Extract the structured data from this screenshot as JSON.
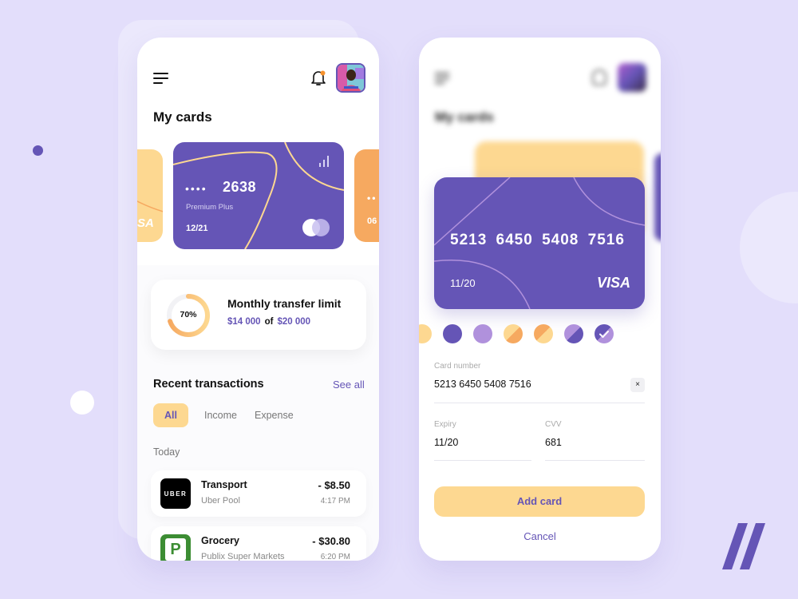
{
  "colors": {
    "background": "#e3defb",
    "accent_purple": "#6555b6",
    "accent_yellow": "#fdd891",
    "accent_orange": "#f6a960",
    "light_purple": "#b091dc",
    "notification_dot": "#f6922d"
  },
  "left_screen": {
    "header": {
      "menu_icon": "hamburger-menu-icon",
      "bell_icon": "bell-icon",
      "has_notification": true,
      "avatar": "user-avatar"
    },
    "title": "My cards",
    "cards": [
      {
        "position": "left-peek",
        "color": "#fdd891",
        "brand": "VISA",
        "brand_visible_text": "SA"
      },
      {
        "position": "center",
        "color": "#6555b6",
        "masked": "••••",
        "last4": "2638",
        "tier": "Premium Plus",
        "expiry": "12/21",
        "brand_icon": "mastercard-icon",
        "signal_icon": "signal-bars-icon"
      },
      {
        "position": "right-peek",
        "color": "#f6a960",
        "masked": "••",
        "expiry_partial": "06"
      }
    ],
    "transfer_limit": {
      "title": "Monthly transfer limit",
      "percent": 70,
      "percent_label": "70%",
      "used": "$14 000",
      "of": "of",
      "total": "$20 000"
    },
    "transactions": {
      "title": "Recent transactions",
      "see_all": "See all",
      "filters": [
        {
          "label": "All",
          "active": true
        },
        {
          "label": "Income",
          "active": false
        },
        {
          "label": "Expense",
          "active": false
        }
      ],
      "group_label": "Today",
      "items": [
        {
          "title": "Transport",
          "subtitle": "Uber Pool",
          "amount": "- $8.50",
          "time": "4:17 PM",
          "logo_text": "UBER",
          "logo_color": "#000000"
        },
        {
          "title": "Grocery",
          "subtitle": "Publix Super Markets",
          "amount": "- $30.80",
          "time": "6:20 PM",
          "logo_text": "P",
          "logo_color": "#3c8d33"
        }
      ]
    }
  },
  "right_screen": {
    "background_title": "My cards",
    "card": {
      "number": "5213 6450 5408 7516",
      "expiry": "11/20",
      "brand": "VISA"
    },
    "color_swatches": [
      {
        "name": "yellow",
        "colors": [
          "#fdd891"
        ],
        "selected": false
      },
      {
        "name": "purple",
        "colors": [
          "#6555b6"
        ],
        "selected": false
      },
      {
        "name": "lavender",
        "colors": [
          "#b091dc"
        ],
        "selected": false
      },
      {
        "name": "yellow-orange",
        "colors": [
          "#fdd891",
          "#f6a960"
        ],
        "selected": false
      },
      {
        "name": "orange-yellow",
        "colors": [
          "#f6a960",
          "#fdd891"
        ],
        "selected": false
      },
      {
        "name": "lavender-purple",
        "colors": [
          "#b091dc",
          "#6555b6"
        ],
        "selected": false
      },
      {
        "name": "purple-lavender",
        "colors": [
          "#6555b6",
          "#b091dc"
        ],
        "selected": true
      }
    ],
    "form": {
      "card_number_label": "Card number",
      "card_number_value": "5213  6450  5408  7516",
      "clear_icon": "×",
      "expiry_label": "Expiry",
      "expiry_value": "11/20",
      "cvv_label": "CVV",
      "cvv_value": "681"
    },
    "add_button": "Add card",
    "cancel_button": "Cancel"
  },
  "decor": {
    "brand_mark": "double-slash-logo"
  }
}
